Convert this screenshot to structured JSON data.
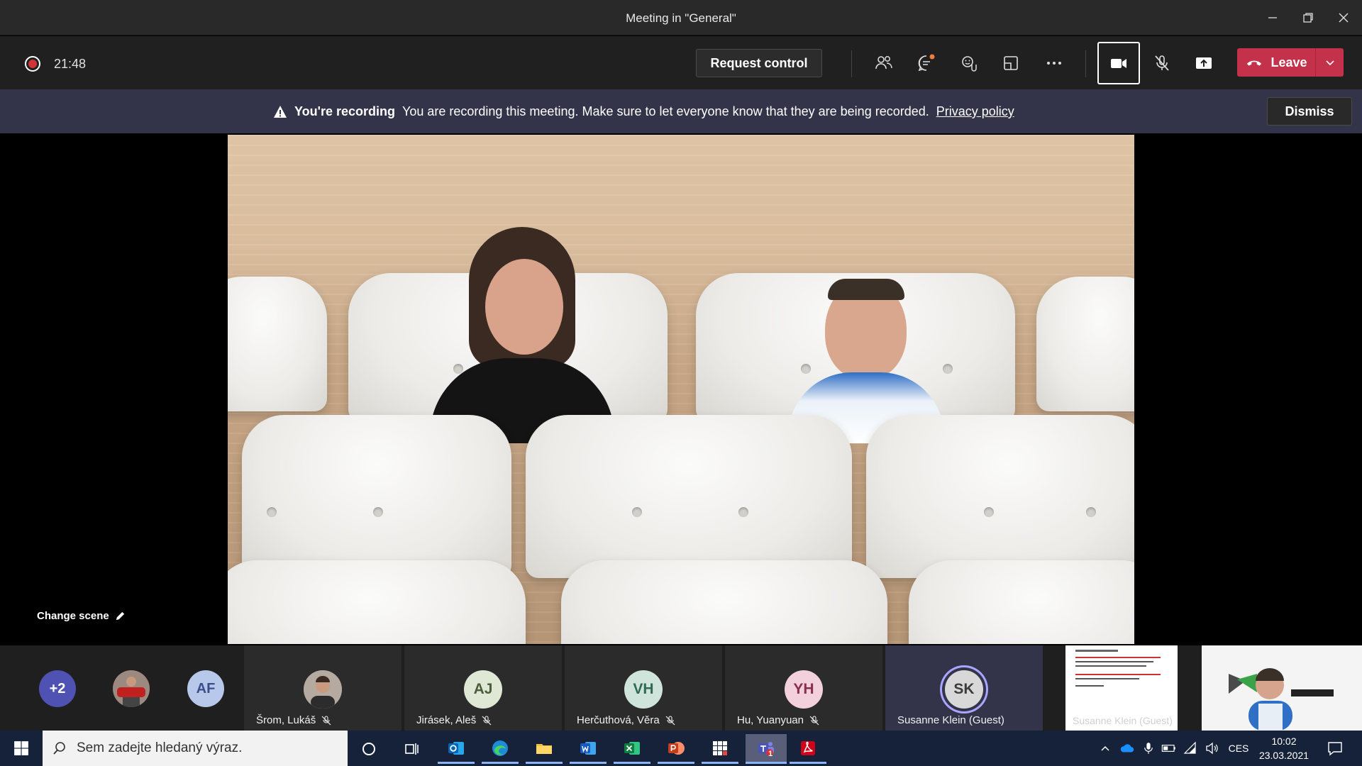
{
  "window": {
    "title": "Meeting in \"General\""
  },
  "toolbar": {
    "timer": "21:48",
    "request_control_label": "Request control",
    "leave_label": "Leave"
  },
  "banner": {
    "title": "You're recording",
    "message": "You are recording this meeting. Make sure to let everyone know that they are being recorded.",
    "link": "Privacy policy",
    "dismiss_label": "Dismiss"
  },
  "stage": {
    "change_scene_label": "Change scene"
  },
  "participants": {
    "overflow_badge": "+2",
    "small_avatar_initials": "AF",
    "tiles": [
      {
        "name": "Šrom, Lukáš",
        "initials": "",
        "muted": true
      },
      {
        "name": "Jirásek, Aleš",
        "initials": "AJ",
        "muted": true
      },
      {
        "name": "Herčuthová, Věra",
        "initials": "VH",
        "muted": true
      },
      {
        "name": "Hu, Yuanyuan",
        "initials": "YH",
        "muted": true
      },
      {
        "name": "Susanne Klein (Guest)",
        "initials": "SK",
        "muted": false
      }
    ],
    "shared_content_name": "Susanne Klein (Guest)"
  },
  "taskbar": {
    "search_placeholder": "Sem zadejte hledaný výraz.",
    "language": "CES",
    "time": "10:02",
    "date": "23.03.2021",
    "teams_badge": "1"
  },
  "colors": {
    "leave": "#c4314b",
    "banner": "#33344a",
    "recording": "#d13438",
    "taskbar": "#16213a"
  }
}
